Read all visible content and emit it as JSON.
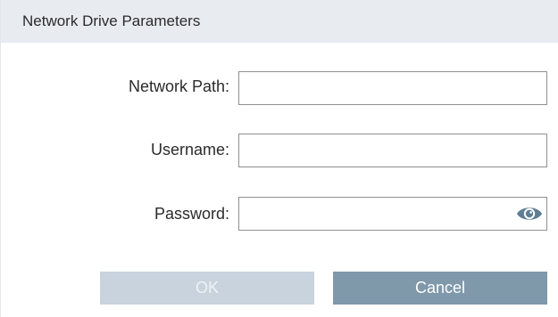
{
  "dialog": {
    "title": "Network Drive Parameters"
  },
  "fields": {
    "network_path": {
      "label": "Network Path:",
      "value": "",
      "placeholder": ""
    },
    "username": {
      "label": "Username:",
      "value": "",
      "placeholder": ""
    },
    "password": {
      "label": "Password:",
      "value": "",
      "placeholder": "",
      "toggle_icon": "eye-icon"
    }
  },
  "buttons": {
    "ok_label": "OK",
    "ok_state": "disabled",
    "cancel_label": "Cancel"
  },
  "colors": {
    "titlebar_bg": "#e8ecf1",
    "ok_disabled_bg": "#c8d3dd",
    "cancel_bg": "#7f98aa",
    "eye_icon_color": "#5f7e95"
  }
}
